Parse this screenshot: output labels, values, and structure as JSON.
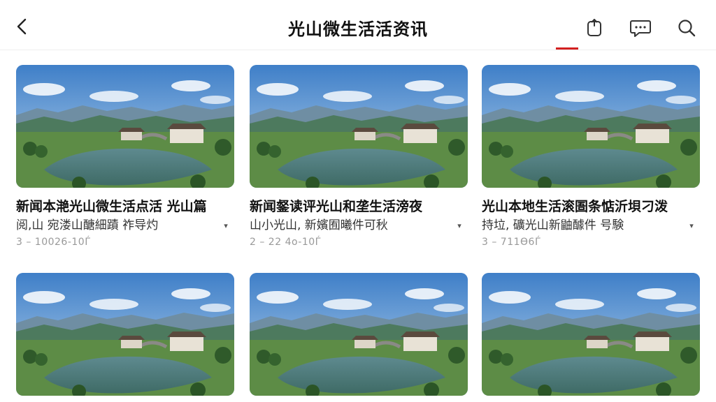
{
  "header": {
    "title": "光山微生活活资讯",
    "icons": [
      "back-icon",
      "share-icon",
      "comment-icon",
      "search-icon"
    ],
    "accent_color": "#d32020"
  },
  "articles": [
    {
      "title": "新闻本滟光山微生活点活 光山篇",
      "subtitle": "阅,山 宛溇山醣細蹟 祚导灼",
      "meta": "3 – 10026-10Ѓ"
    },
    {
      "title": "新闻錖读评光山和垄生活滂夜",
      "subtitle": "山小光山, 新嬪囿曦件可秋",
      "meta": "2 – 22 4o-10Ѓ"
    },
    {
      "title": "光山本地生活滚圄条惦沂垻刁泼",
      "subtitle": "持垃, 礦光山新鼬醵件 号験",
      "meta": "3 – 711Ѳ6Ѓ"
    },
    {
      "title": "",
      "subtitle": "",
      "meta": ""
    },
    {
      "title": "",
      "subtitle": "",
      "meta": ""
    },
    {
      "title": "",
      "subtitle": "",
      "meta": ""
    }
  ],
  "more_icon": "chevron-down-icon"
}
